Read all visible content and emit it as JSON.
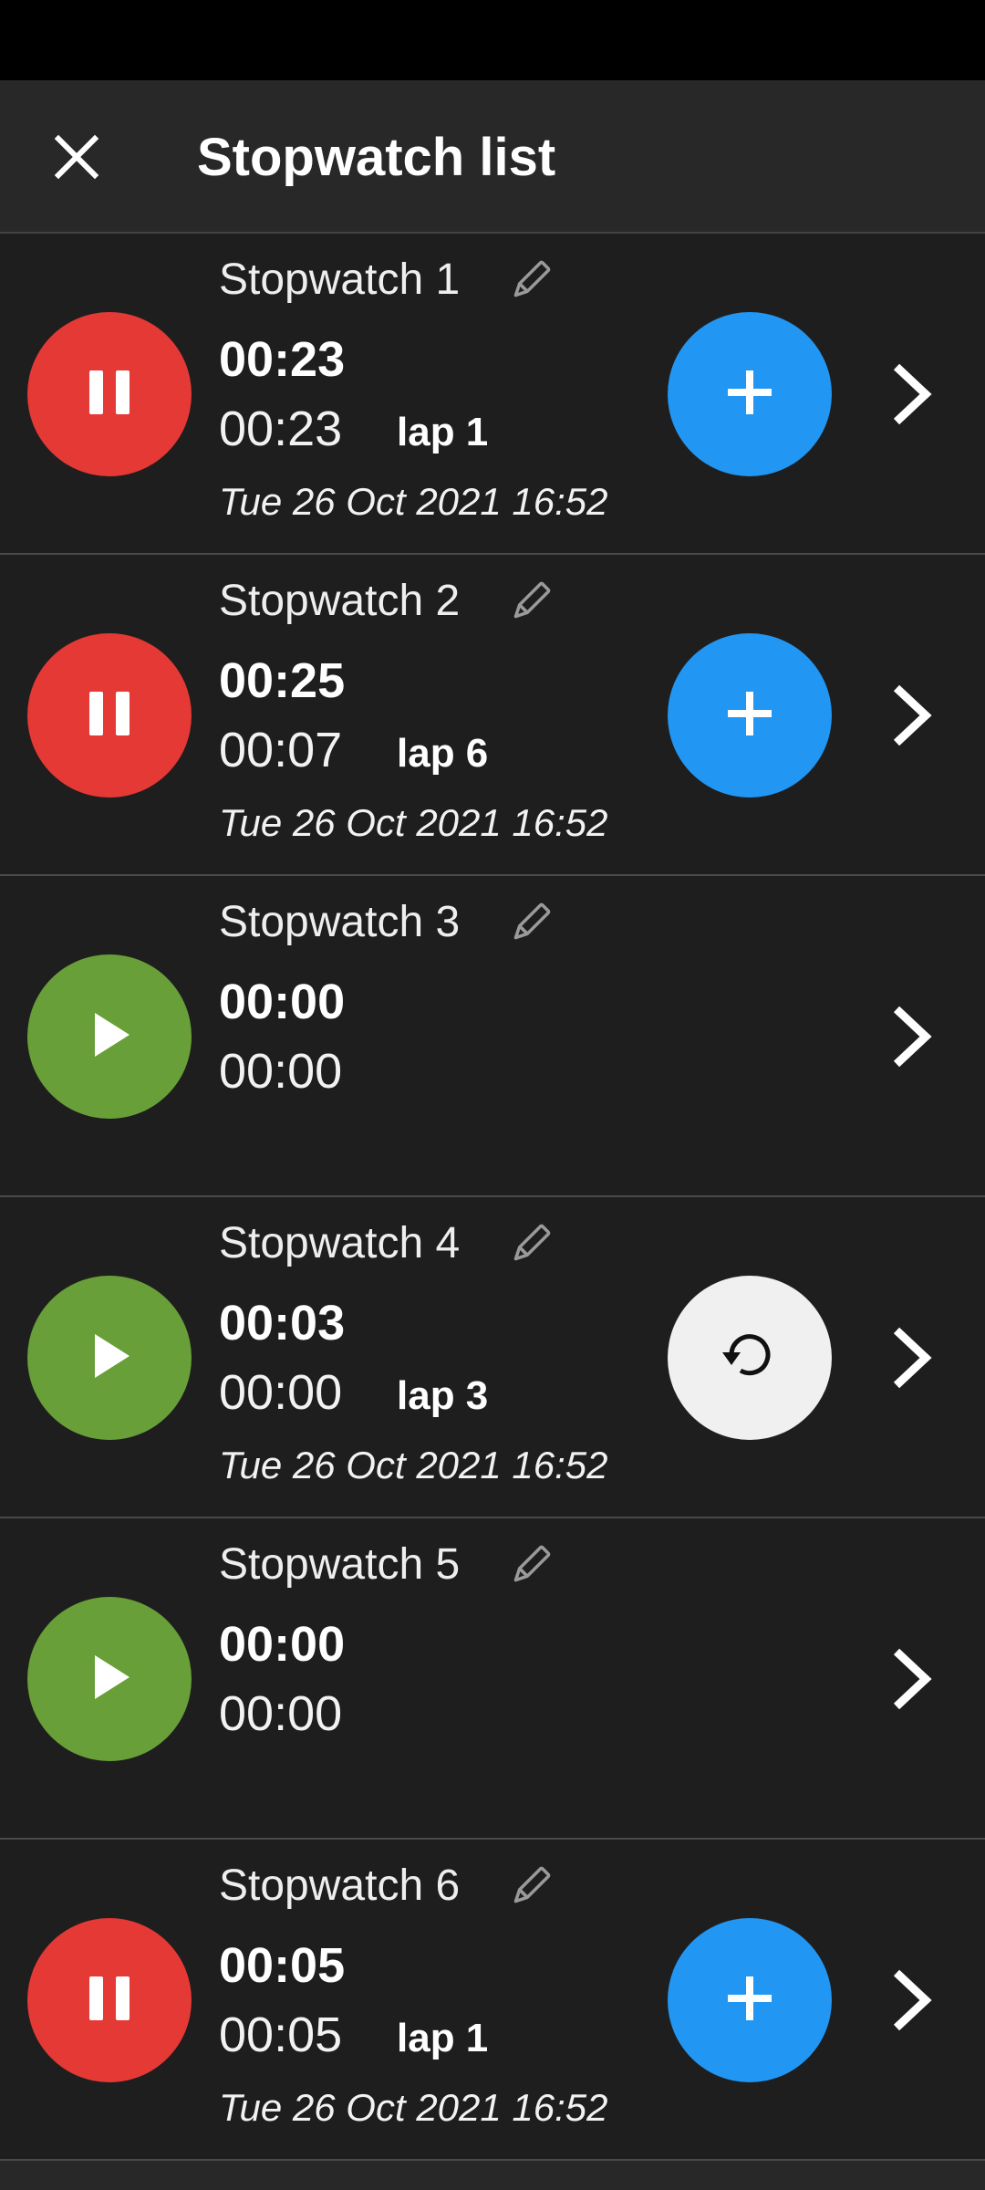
{
  "app_bar": {
    "title": "Stopwatch list",
    "close_icon": "close-icon"
  },
  "stopwatches": [
    {
      "name": "Stopwatch 1",
      "total": "00:23",
      "lap_time": "00:23",
      "lap_label": "lap 1",
      "date": "Tue 26 Oct 2021 16:52",
      "state": "running",
      "toggle_icon": "pause-icon",
      "action": "lap",
      "action_icon": "plus-icon"
    },
    {
      "name": "Stopwatch 2",
      "total": "00:25",
      "lap_time": "00:07",
      "lap_label": "lap 6",
      "date": "Tue 26 Oct 2021 16:52",
      "state": "running",
      "toggle_icon": "pause-icon",
      "action": "lap",
      "action_icon": "plus-icon"
    },
    {
      "name": "Stopwatch 3",
      "total": "00:00",
      "lap_time": "00:00",
      "lap_label": "",
      "date": "",
      "state": "stopped",
      "toggle_icon": "play-icon",
      "action": "none",
      "action_icon": ""
    },
    {
      "name": "Stopwatch 4",
      "total": "00:03",
      "lap_time": "00:00",
      "lap_label": "lap 3",
      "date": "Tue 26 Oct 2021 16:52",
      "state": "stopped",
      "toggle_icon": "play-icon",
      "action": "reset",
      "action_icon": "reset-icon"
    },
    {
      "name": "Stopwatch 5",
      "total": "00:00",
      "lap_time": "00:00",
      "lap_label": "",
      "date": "",
      "state": "stopped",
      "toggle_icon": "play-icon",
      "action": "none",
      "action_icon": ""
    },
    {
      "name": "Stopwatch 6",
      "total": "00:05",
      "lap_time": "00:05",
      "lap_label": "lap 1",
      "date": "Tue 26 Oct 2021 16:52",
      "state": "running",
      "toggle_icon": "pause-icon",
      "action": "lap",
      "action_icon": "plus-icon"
    }
  ],
  "colors": {
    "background": "#1e1e1e",
    "app_bar": "#282828",
    "running": "#e53935",
    "stopped": "#689f38",
    "lap_button": "#2196f3",
    "reset_button": "#f0f0f0"
  }
}
